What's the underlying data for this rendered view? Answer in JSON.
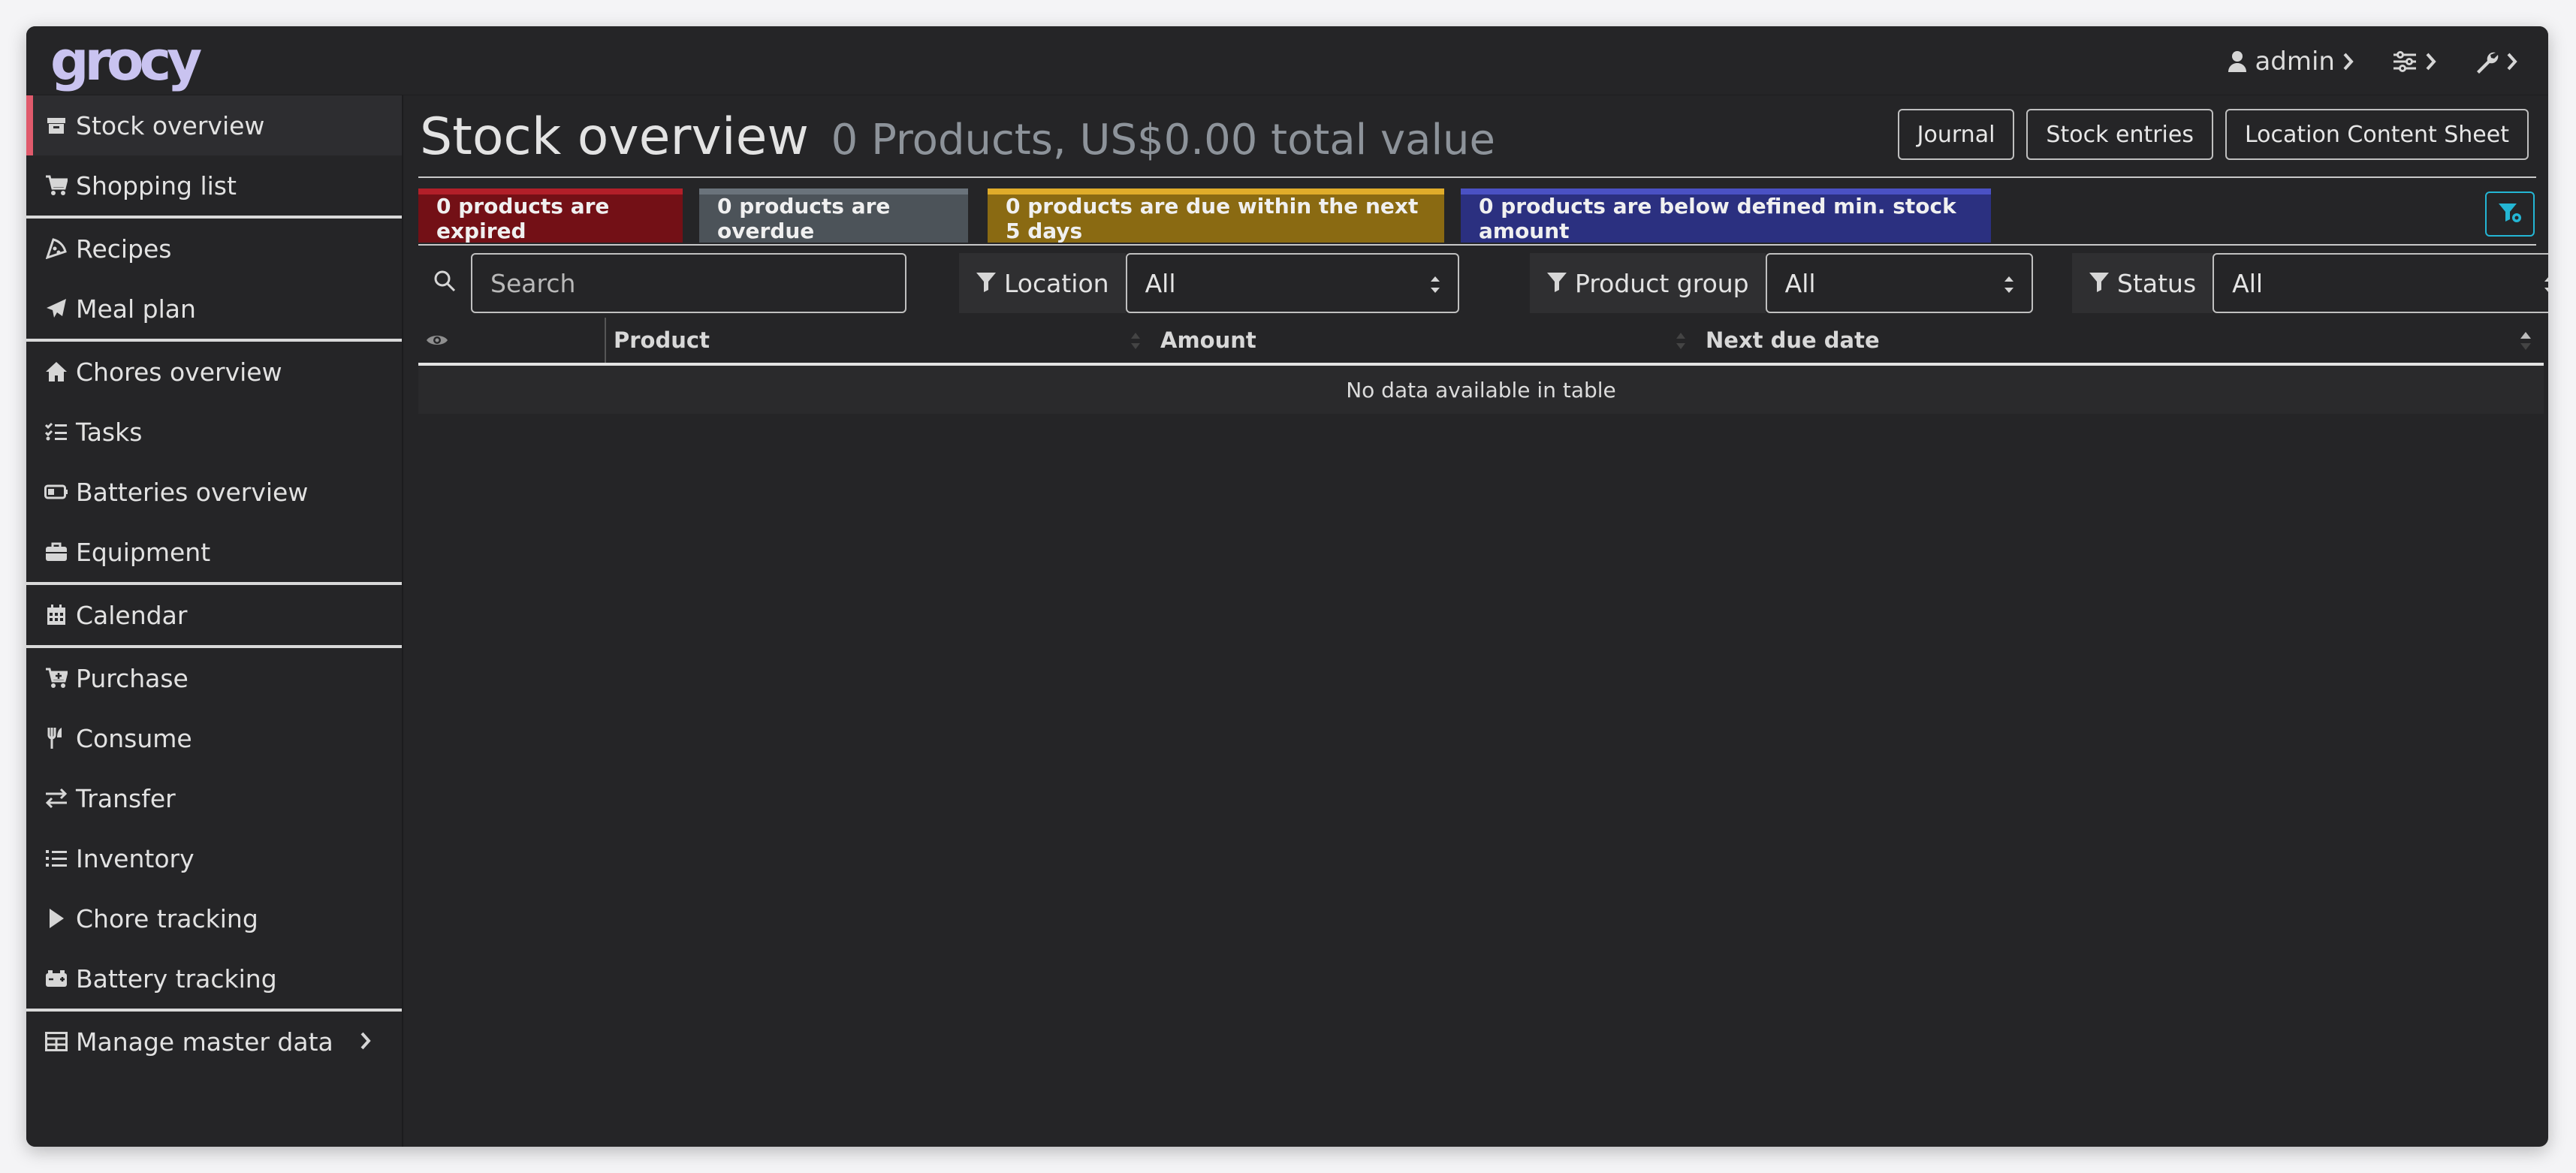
{
  "app": {
    "logo_text": "grocy"
  },
  "topnav": {
    "user_label": "admin"
  },
  "sidebar": {
    "items": [
      {
        "label": "Stock overview",
        "icon": "box-icon",
        "active": true
      },
      {
        "label": "Shopping list",
        "icon": "cart-icon"
      },
      {
        "label": "Recipes",
        "icon": "pizza-icon"
      },
      {
        "label": "Meal plan",
        "icon": "paper-plane-icon"
      },
      {
        "label": "Chores overview",
        "icon": "home-icon"
      },
      {
        "label": "Tasks",
        "icon": "tasks-icon"
      },
      {
        "label": "Batteries overview",
        "icon": "battery-icon"
      },
      {
        "label": "Equipment",
        "icon": "toolbox-icon"
      },
      {
        "label": "Calendar",
        "icon": "calendar-icon"
      },
      {
        "label": "Purchase",
        "icon": "cart-plus-icon"
      },
      {
        "label": "Consume",
        "icon": "utensils-icon"
      },
      {
        "label": "Transfer",
        "icon": "exchange-icon"
      },
      {
        "label": "Inventory",
        "icon": "list-icon"
      },
      {
        "label": "Chore tracking",
        "icon": "play-icon"
      },
      {
        "label": "Battery tracking",
        "icon": "car-battery-icon"
      },
      {
        "label": "Manage master data",
        "icon": "table-icon"
      }
    ]
  },
  "main": {
    "title": "Stock overview",
    "subtitle": "0 Products, US$0.00 total value",
    "buttons": {
      "journal": "Journal",
      "stock_entries": "Stock entries",
      "location_sheet": "Location Content Sheet"
    },
    "badges": {
      "expired": "0 products are expired",
      "overdue": "0 products are overdue",
      "due_soon": "0 products are due within the next 5 days",
      "below_min": "0 products are below defined min. stock amount"
    },
    "filters": {
      "search_placeholder": "Search",
      "location_label": "Location",
      "location_value": "All",
      "product_group_label": "Product group",
      "product_group_value": "All",
      "status_label": "Status",
      "status_value": "All"
    },
    "table": {
      "columns": [
        "",
        "Product",
        "Amount",
        "Next due date"
      ],
      "empty_message": "No data available in table"
    }
  },
  "colors": {
    "accent_active": "#e05a6c",
    "expired": "#731016",
    "overdue": "#4c5359",
    "due_soon": "#8a6a12",
    "below_min": "#2b3080",
    "info": "#24b6d4"
  }
}
